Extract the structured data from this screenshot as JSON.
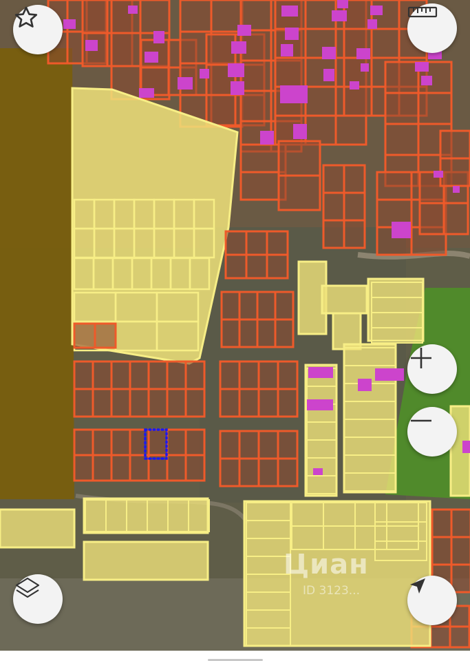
{
  "map": {
    "colors": {
      "imagery_base": "#5c5a45",
      "field_dark": "#7a5e0c",
      "field_green": "#4f8f28",
      "parcel_yellow_fill": "#efe27a",
      "parcel_yellow_stroke": "#f7ee86",
      "parcel_red_fill": "#8a4a32",
      "parcel_red_stroke": "#ee5a2a",
      "building_magenta": "#cc44cc",
      "selected_outline": "#1a1aee",
      "control_background": "#f3f3f3",
      "control_icon": "#333333"
    },
    "watermark": {
      "brand": "Циан",
      "id_text": "ID 3123..."
    }
  },
  "controls": {
    "favorite": {
      "icon": "star-icon"
    },
    "ruler": {
      "icon": "ruler-icon"
    },
    "zoom_in": {
      "icon": "plus-icon"
    },
    "zoom_out": {
      "icon": "minus-icon"
    },
    "layers": {
      "icon": "layers-icon"
    },
    "locate": {
      "icon": "navigation-arrow-icon"
    }
  }
}
